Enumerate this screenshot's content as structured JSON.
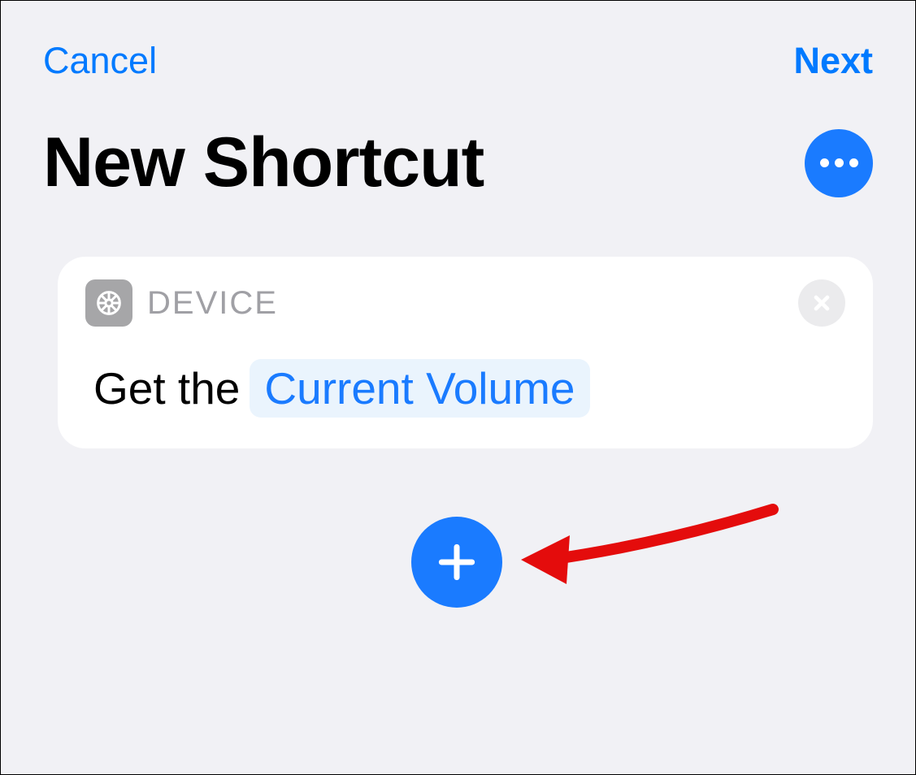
{
  "header": {
    "cancel_label": "Cancel",
    "next_label": "Next"
  },
  "title": "New Shortcut",
  "action_card": {
    "category_label": "DEVICE",
    "prefix_text": "Get the ",
    "parameter": "Current Volume"
  }
}
